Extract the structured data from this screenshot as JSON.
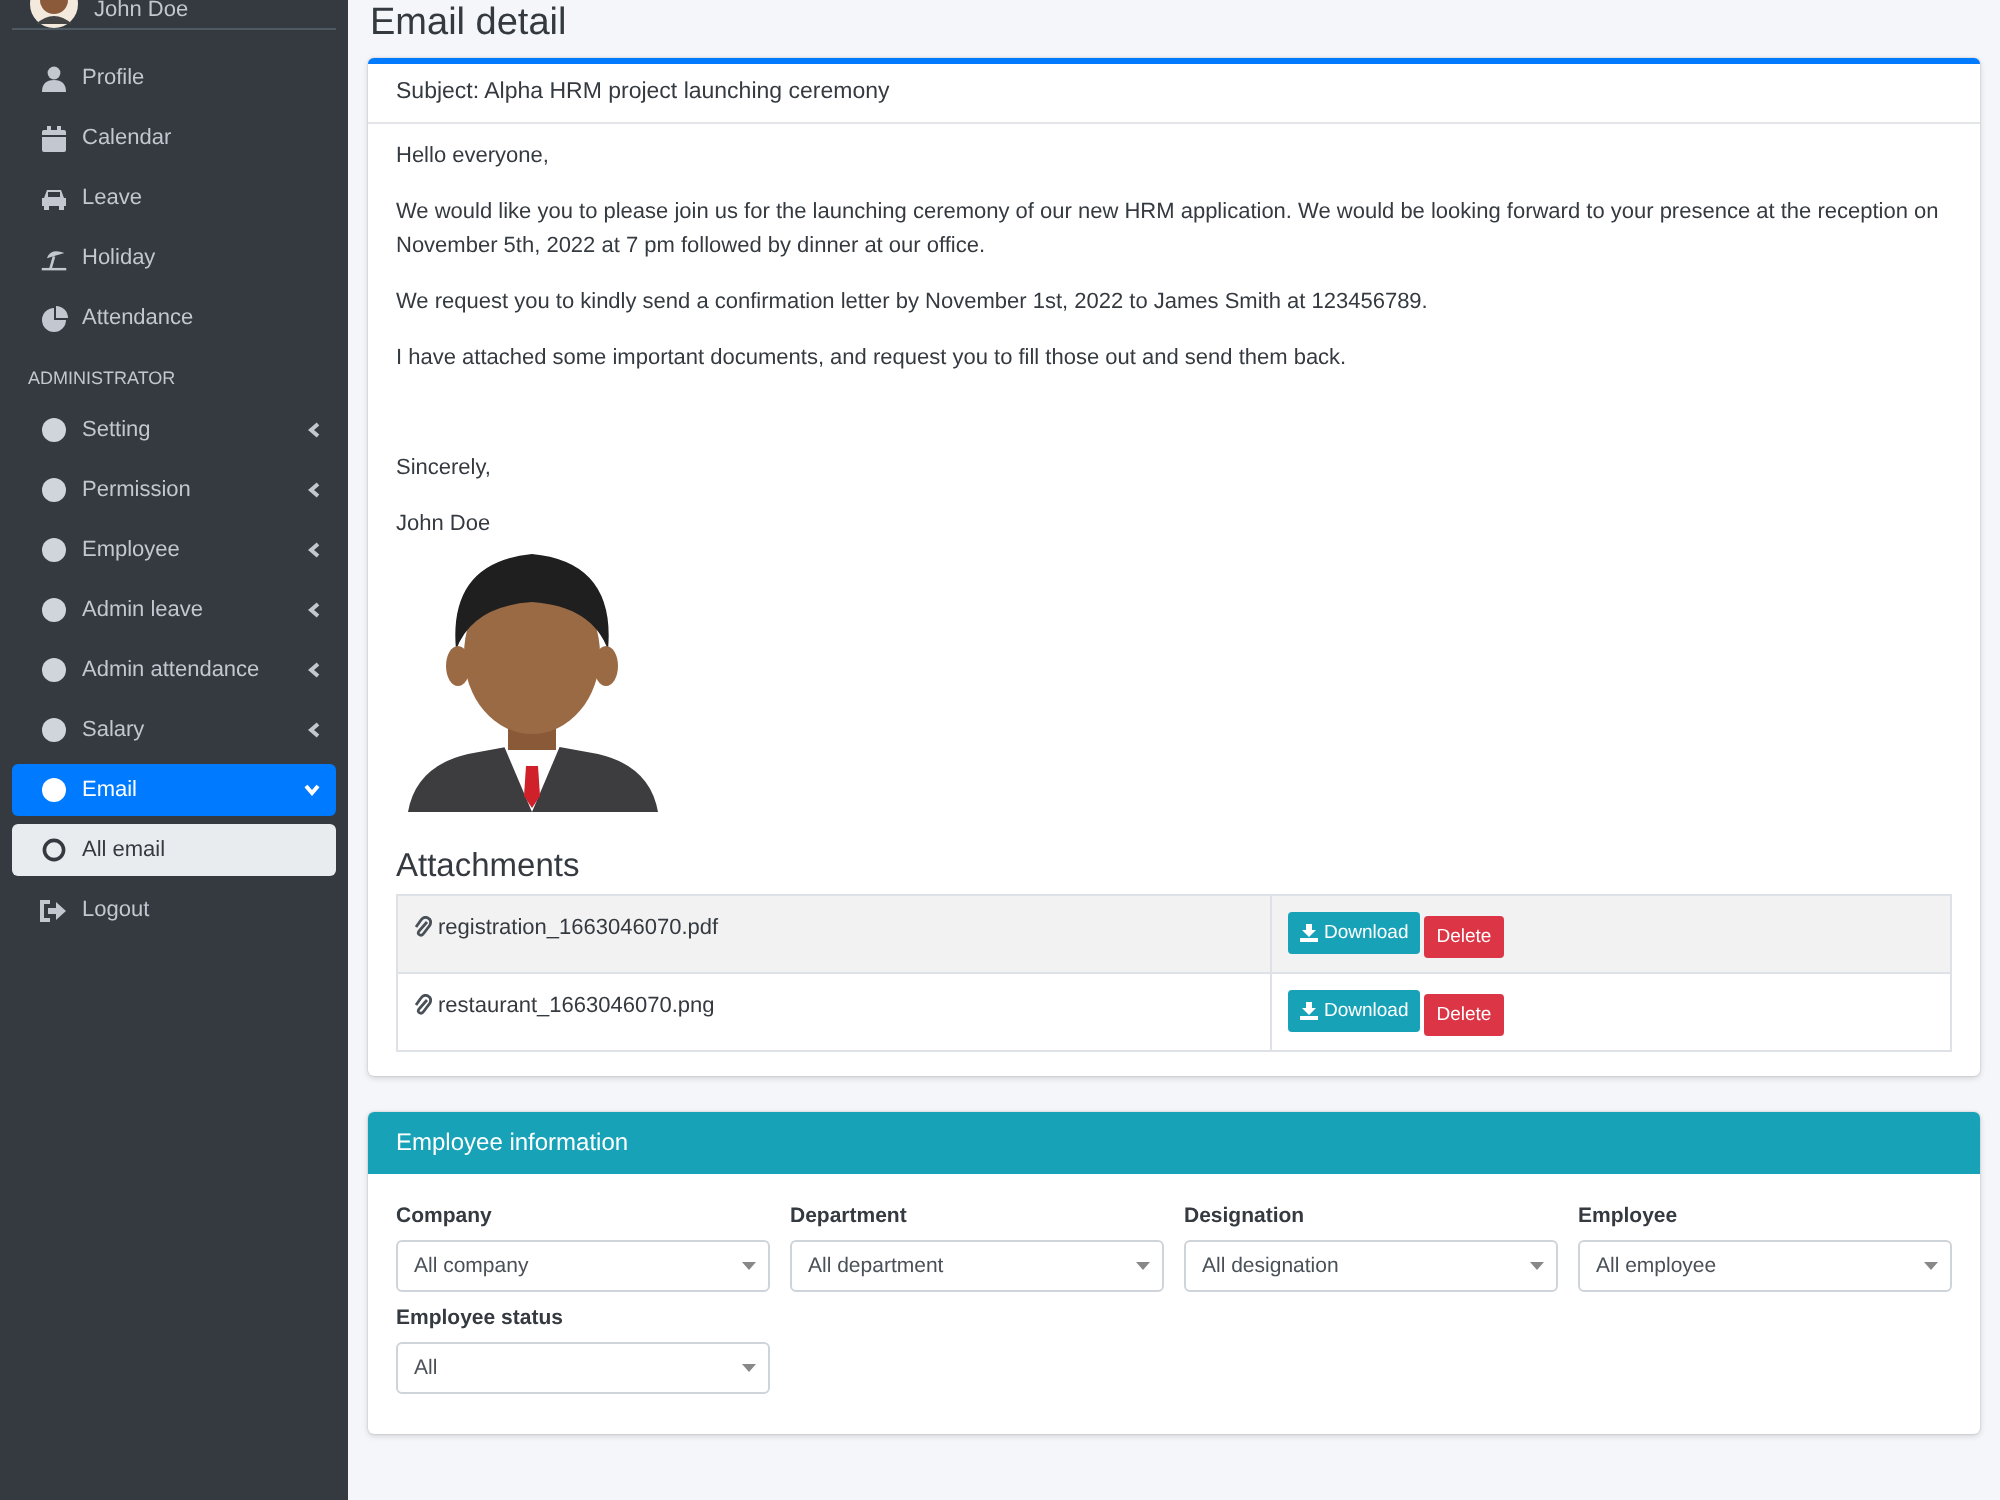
{
  "sidebar": {
    "user": {
      "name": "John Doe"
    },
    "items": [
      {
        "label": "Profile",
        "selected": false
      },
      {
        "label": "Calendar",
        "selected": false
      },
      {
        "label": "Leave",
        "selected": false
      },
      {
        "label": "Holiday",
        "selected": false
      },
      {
        "label": "Attendance",
        "selected": false
      }
    ],
    "section": "ADMINISTRATOR",
    "admin_items": [
      {
        "label": "Setting",
        "selected": false,
        "expanded": false
      },
      {
        "label": "Permission",
        "selected": false,
        "expanded": false
      },
      {
        "label": "Employee",
        "selected": false,
        "expanded": false
      },
      {
        "label": "Admin leave",
        "selected": false,
        "expanded": false
      },
      {
        "label": "Admin attendance",
        "selected": false,
        "expanded": false
      },
      {
        "label": "Salary",
        "selected": false,
        "expanded": false
      },
      {
        "label": "Email",
        "selected": true,
        "expanded": true,
        "children": [
          {
            "label": "All email",
            "selected": true
          }
        ]
      }
    ],
    "logout": "Logout"
  },
  "page_title": "Email detail",
  "email": {
    "subject": "Subject: Alpha HRM project launching ceremony",
    "greeting": "Hello everyone,",
    "paragraphs": [
      "We would like you to please join us for the launching ceremony of our new HRM application. We would be looking forward to your presence at the reception on November 5th, 2022 at 7 pm followed by dinner at our office.",
      "We request you to kindly send a confirmation letter by November 1st, 2022 to James Smith at 123456789.",
      "I have attached some important documents, and request you to fill those out and send them back."
    ],
    "signoff": "Sincerely,",
    "signature": "John Doe",
    "attachments_title": "Attachments",
    "attachments": [
      {
        "name": "registration_1663046070.pdf",
        "actions": [
          {
            "label": "Download",
            "kind": "download"
          },
          {
            "label": "Delete",
            "kind": "delete"
          }
        ]
      },
      {
        "name": "restaurant_1663046070.png",
        "actions": [
          {
            "label": "Download",
            "kind": "download"
          },
          {
            "label": "Delete",
            "kind": "delete"
          }
        ]
      }
    ]
  },
  "employee_information": {
    "title": "Employee information",
    "filters": [
      {
        "label": "Company",
        "value": "All company"
      },
      {
        "label": "Department",
        "value": "All department"
      },
      {
        "label": "Designation",
        "value": "All designation"
      },
      {
        "label": "Employee",
        "value": "All employee"
      },
      {
        "label": "Employee status",
        "value": "All"
      }
    ]
  }
}
